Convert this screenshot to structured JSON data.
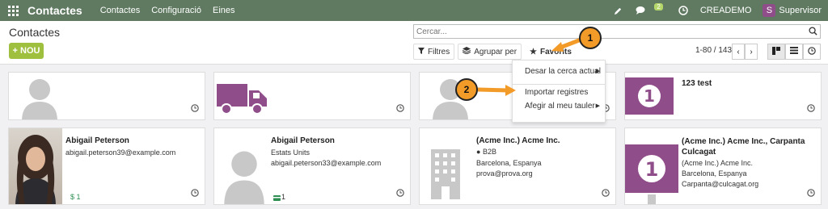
{
  "navbar": {
    "brand": "Contactes",
    "menus": [
      "Contactes",
      "Configuració",
      "Eines"
    ],
    "chat_badge": "2",
    "company": "CREADEMO",
    "user_initial": "S",
    "user_name": "Supervisor"
  },
  "control_panel": {
    "breadcrumb": "Contactes",
    "new_button": "+ NOU",
    "search_placeholder": "Cercar...",
    "filters_label": "Filtres",
    "group_by_label": "Agrupar per",
    "favorites_label": "Favorits",
    "pager_value": "1-80 / 143"
  },
  "favorites_menu": {
    "items": [
      {
        "label": "Desar la cerca actual",
        "has_submenu": true
      },
      {
        "label": "Importar registres",
        "has_submenu": false
      },
      {
        "label": "Afegir al meu tauler",
        "has_submenu": true
      }
    ]
  },
  "callouts": [
    "1",
    "2"
  ],
  "cards": [
    {
      "name": "",
      "lines": [],
      "footer": "",
      "image": "person-placeholder"
    },
    {
      "name": "",
      "lines": [],
      "footer": "",
      "image": "truck"
    },
    {
      "name": "",
      "lines": [],
      "footer": "",
      "image": "person-placeholder"
    },
    {
      "name": "123 test",
      "lines": [],
      "footer": "",
      "image": "banknote"
    },
    {
      "name": "Abigail Peterson",
      "lines": [
        "abigail.peterson39@example.com"
      ],
      "footer": "$ 1",
      "image": "photo"
    },
    {
      "name": "Abigail Peterson",
      "lines": [
        "Estats Units",
        "abigail.peterson33@example.com"
      ],
      "footer": "1",
      "image": "person-placeholder"
    },
    {
      "name": "(Acme Inc.) Acme Inc.",
      "lines": [
        "B2B",
        "Barcelona, Espanya",
        "prova@prova.org"
      ],
      "footer": "",
      "image": "building"
    },
    {
      "name": "(Acme Inc.) Acme Inc., Carpanta Culcagat",
      "lines": [
        "(Acme Inc.) Acme Inc.",
        "Barcelona, Espanya",
        "Carpanta@culcagat.org"
      ],
      "footer": "",
      "image": "banknote"
    }
  ],
  "colors": {
    "navbar": "#5f7a61",
    "new_button": "#9fbf3f",
    "accent_purple": "#8f4d8a",
    "callout": "#f29b28"
  }
}
